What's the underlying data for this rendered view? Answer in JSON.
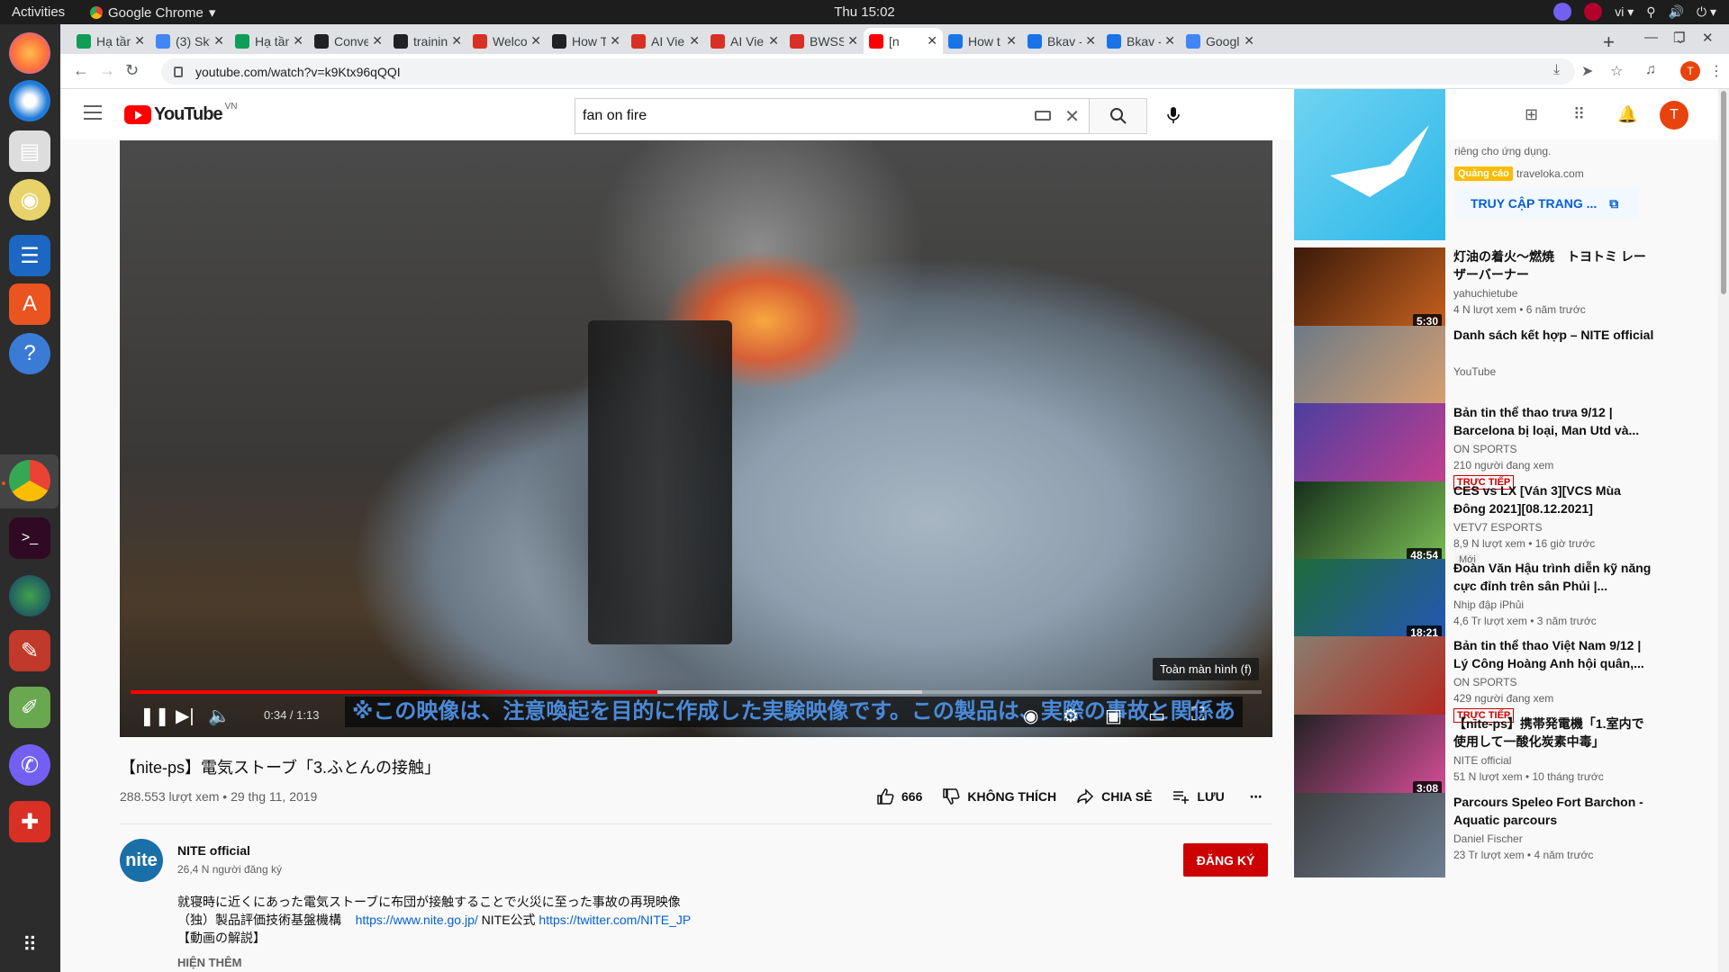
{
  "os": {
    "activities": "Activities",
    "app_name": "Google Chrome",
    "clock": "Thu 15:02",
    "lang": "vi"
  },
  "tabs": [
    {
      "title": "Hạ tần",
      "color": "#0f9d58",
      "icon": "sheets-icon"
    },
    {
      "title": "(3) Sky",
      "color": "#4285f4",
      "icon": "skype-icon"
    },
    {
      "title": "Hạ tần",
      "color": "#0f9d58",
      "icon": "sheets-icon"
    },
    {
      "title": "Conve",
      "color": "#202124",
      "icon": "circle-icon"
    },
    {
      "title": "trainin",
      "color": "#202124",
      "icon": "github-icon"
    },
    {
      "title": "Welco",
      "color": "#d93025",
      "icon": "shield-icon"
    },
    {
      "title": "How T",
      "color": "#202124",
      "icon": "lt-icon"
    },
    {
      "title": "AI Vie",
      "color": "#d93025",
      "icon": "ai-icon"
    },
    {
      "title": "AI Vie",
      "color": "#d93025",
      "icon": "ai-icon"
    },
    {
      "title": "BWSS",
      "color": "#d93025",
      "icon": "shield-icon"
    },
    {
      "title": "[n",
      "color": "#ff0000",
      "icon": "youtube-icon"
    },
    {
      "title": "How t",
      "color": "#1a73e8",
      "icon": "doc-icon"
    },
    {
      "title": "Bkav -",
      "color": "#1a73e8",
      "icon": "bkav-icon"
    },
    {
      "title": "Bkav -",
      "color": "#1a73e8",
      "icon": "bkav-icon"
    },
    {
      "title": "Googl",
      "color": "#4285f4",
      "icon": "translate-icon"
    }
  ],
  "address": {
    "url": "youtube.com/watch?v=k9Ktx96qQQI",
    "profile_letter": "T"
  },
  "youtube": {
    "logo_text": "YouTube",
    "country": "VN",
    "search_value": "fan on fire",
    "avatar_letter": "T"
  },
  "player": {
    "time": "0:34 / 1:13",
    "progress_played": 0.466,
    "progress_loaded": 0.7,
    "subtitle": "※この映像は、注意喚起を目的に作成した実験映像です。この製品は、実際の事故と関係あ",
    "tooltip": "Toàn màn hình (f)"
  },
  "video": {
    "title": "【nite-ps】電気ストーブ「3.ふとんの接触」",
    "meta": "288.553 lượt xem • 29 thg 11, 2019",
    "likes": "666",
    "dislike_label": "KHÔNG THÍCH",
    "share_label": "CHIA SẺ",
    "save_label": "LƯU"
  },
  "channel": {
    "avatar_text": "nite",
    "name": "NITE official",
    "subs": "26,4 N người đăng ký",
    "subscribe_label": "ĐĂNG KÝ"
  },
  "description": {
    "line1": "就寝時に近くにあった電気ストーブに布団が接触することで火災に至った事故の再現映像",
    "line2_prefix": "（独）製品評価技術基盤機構",
    "link1": "https://www.nite.go.jp/",
    "line2_mid": " NITE公式 ",
    "link2": "https://twitter.com/NITE_JP",
    "line3": "【動画の解説】",
    "show_more": "HIỆN THÊM"
  },
  "ad": {
    "text": "riêng cho ứng dụng.",
    "badge": "Quảng cáo",
    "domain": "traveloka.com",
    "cta": "TRUY CẬP TRANG ..."
  },
  "recommendations": [
    {
      "title": "灯油の着火〜燃焼　トヨトミ レーザーバーナー",
      "channel": "yahuchietube",
      "views": "4 N lượt xem • 6 năm trước",
      "duration": "5:30",
      "thumb": "#3a1a0a",
      "thumb2": "#c9621f"
    },
    {
      "title": "Danh sách kết hợp – NITE official",
      "channel": "YouTube",
      "views": "",
      "duration": "",
      "thumb": "#6d7a86",
      "thumb2": "#d9a070"
    },
    {
      "title": "Bản tin thể thao trưa 9/12 | Barcelona bị loại, Man Utd và...",
      "channel": "ON SPORTS",
      "views": "210 người đang xem",
      "duration": "",
      "live": "TRỰC TIẾP",
      "thumb": "#4b3fa0",
      "thumb2": "#c63f8e"
    },
    {
      "title": "CES vs LX [Ván 3][VCS Mùa Đông 2021][08.12.2021]",
      "channel": "VETV7 ESPORTS",
      "views": "8,9 N lượt xem • 16 giờ trước",
      "duration": "48:54",
      "new": "Mới",
      "thumb": "#16301c",
      "thumb2": "#7bbf55"
    },
    {
      "title": "Đoàn Văn Hậu trình diễn kỹ năng cực đỉnh trên sân Phủi |...",
      "channel": "Nhịp đập iPhủi",
      "views": "4,6 Tr lượt xem • 3 năm trước",
      "duration": "18:21",
      "thumb": "#1f6b3a",
      "thumb2": "#2456b8"
    },
    {
      "title": "Bản tin thể thao Việt Nam 9/12 | Lý Công Hoàng Anh hội quân,...",
      "channel": "ON SPORTS",
      "views": "429 người đang xem",
      "duration": "",
      "live": "TRỰC TIẾP",
      "thumb": "#8a7d6d",
      "thumb2": "#b5281f"
    },
    {
      "title": "【nite-ps】携帯発電機「1.室内で使用して一酸化炭素中毒」",
      "channel": "NITE official",
      "views": "51 N lượt xem • 10 tháng trước",
      "duration": "3:08",
      "thumb": "#222",
      "thumb2": "#d94e9b"
    },
    {
      "title": "Parcours Speleo Fort Barchon - Aquatic parcours",
      "channel": "Daniel Fischer",
      "views": "23 Tr lượt xem • 4 năm trước",
      "duration": "",
      "thumb": "#3d3d3d",
      "thumb2": "#6e7f92"
    }
  ]
}
